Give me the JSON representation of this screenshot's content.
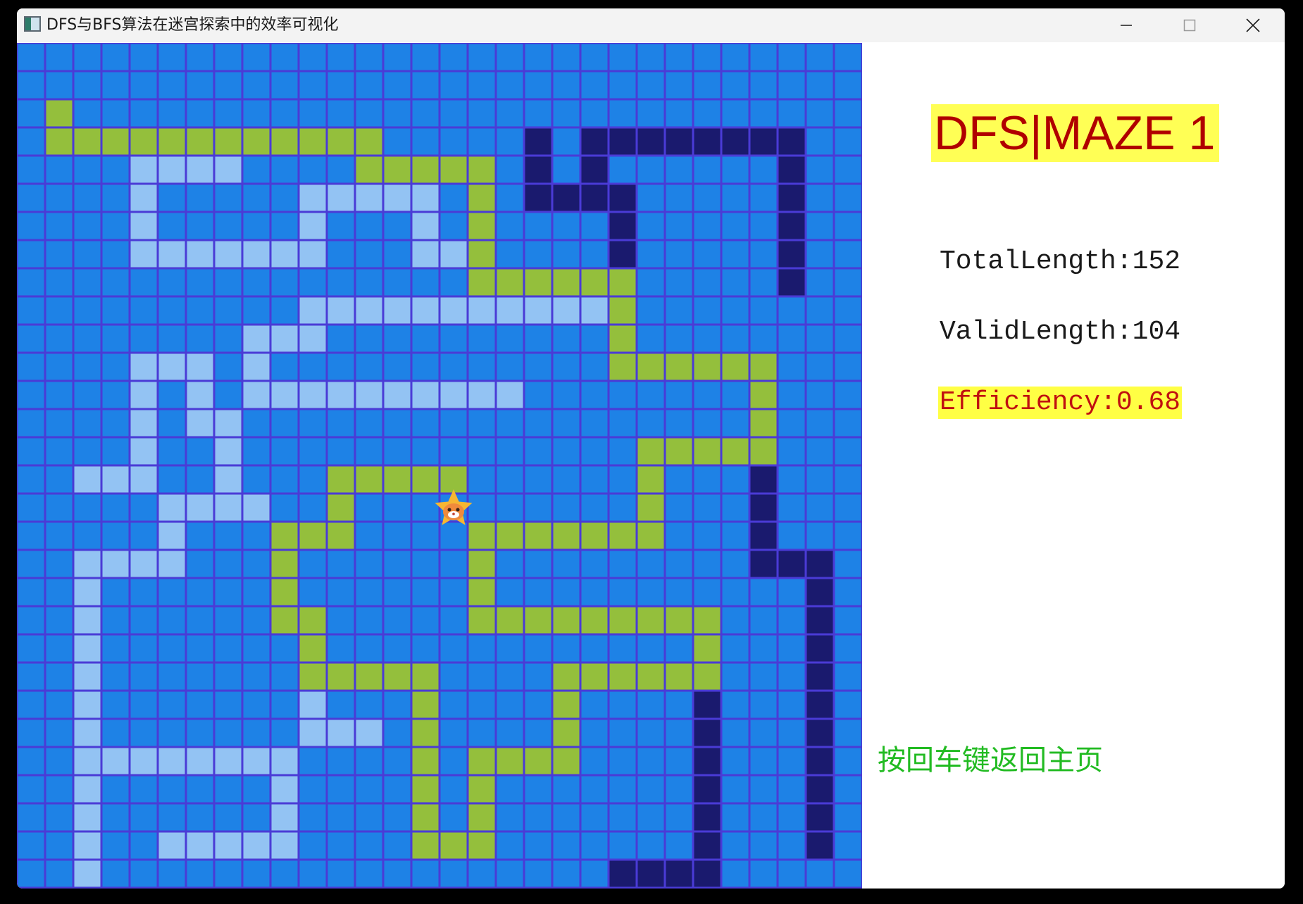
{
  "window": {
    "title": "DFS与BFS算法在迷宫探索中的效率可视化",
    "icon": "app-window-icon",
    "controls": [
      "minimize-icon",
      "maximize-icon",
      "close-icon"
    ]
  },
  "maze": {
    "cols": 30,
    "rows": 30,
    "colors": {
      "empty": "#1e82e6",
      "visited": "#93c3f3",
      "path": "#94bf3c",
      "dead_end": "#1a1a6e",
      "grid": "#4a3bd6"
    },
    "cells": {
      "visited": [
        [
          4,
          4
        ],
        [
          4,
          5
        ],
        [
          4,
          6
        ],
        [
          4,
          7
        ],
        [
          5,
          4
        ],
        [
          6,
          4
        ],
        [
          7,
          4
        ],
        [
          7,
          5
        ],
        [
          7,
          6
        ],
        [
          7,
          7
        ],
        [
          7,
          8
        ],
        [
          7,
          9
        ],
        [
          7,
          10
        ],
        [
          5,
          10
        ],
        [
          5,
          11
        ],
        [
          5,
          12
        ],
        [
          5,
          13
        ],
        [
          5,
          14
        ],
        [
          6,
          10
        ],
        [
          6,
          14
        ],
        [
          7,
          14
        ],
        [
          7,
          15
        ],
        [
          9,
          10
        ],
        [
          9,
          11
        ],
        [
          9,
          12
        ],
        [
          9,
          13
        ],
        [
          9,
          14
        ],
        [
          9,
          15
        ],
        [
          9,
          16
        ],
        [
          9,
          17
        ],
        [
          9,
          18
        ],
        [
          9,
          19
        ],
        [
          9,
          20
        ],
        [
          10,
          8
        ],
        [
          10,
          9
        ],
        [
          10,
          10
        ],
        [
          11,
          8
        ],
        [
          11,
          4
        ],
        [
          11,
          5
        ],
        [
          11,
          6
        ],
        [
          12,
          4
        ],
        [
          12,
          6
        ],
        [
          12,
          8
        ],
        [
          12,
          9
        ],
        [
          12,
          10
        ],
        [
          12,
          11
        ],
        [
          12,
          12
        ],
        [
          12,
          13
        ],
        [
          12,
          14
        ],
        [
          12,
          15
        ],
        [
          12,
          16
        ],
        [
          12,
          17
        ],
        [
          13,
          4
        ],
        [
          13,
          6
        ],
        [
          13,
          7
        ],
        [
          14,
          4
        ],
        [
          14,
          7
        ],
        [
          15,
          2
        ],
        [
          15,
          3
        ],
        [
          15,
          4
        ],
        [
          15,
          7
        ],
        [
          16,
          5
        ],
        [
          16,
          6
        ],
        [
          16,
          7
        ],
        [
          16,
          8
        ],
        [
          17,
          5
        ],
        [
          18,
          2
        ],
        [
          18,
          3
        ],
        [
          18,
          4
        ],
        [
          18,
          5
        ],
        [
          19,
          2
        ],
        [
          20,
          2
        ],
        [
          21,
          2
        ],
        [
          22,
          2
        ],
        [
          23,
          2
        ],
        [
          23,
          10
        ],
        [
          24,
          2
        ],
        [
          24,
          10
        ],
        [
          24,
          11
        ],
        [
          24,
          12
        ],
        [
          25,
          2
        ],
        [
          25,
          3
        ],
        [
          25,
          4
        ],
        [
          25,
          5
        ],
        [
          25,
          6
        ],
        [
          25,
          7
        ],
        [
          25,
          8
        ],
        [
          25,
          9
        ],
        [
          26,
          2
        ],
        [
          26,
          9
        ],
        [
          27,
          2
        ],
        [
          27,
          9
        ],
        [
          28,
          2
        ],
        [
          28,
          5
        ],
        [
          28,
          6
        ],
        [
          28,
          7
        ],
        [
          28,
          8
        ],
        [
          28,
          9
        ],
        [
          29,
          2
        ]
      ],
      "path": [
        [
          2,
          1
        ],
        [
          3,
          1
        ],
        [
          3,
          2
        ],
        [
          3,
          3
        ],
        [
          3,
          4
        ],
        [
          3,
          5
        ],
        [
          3,
          6
        ],
        [
          3,
          7
        ],
        [
          3,
          8
        ],
        [
          3,
          9
        ],
        [
          3,
          10
        ],
        [
          3,
          11
        ],
        [
          3,
          12
        ],
        [
          4,
          12
        ],
        [
          4,
          13
        ],
        [
          4,
          14
        ],
        [
          4,
          15
        ],
        [
          4,
          16
        ],
        [
          5,
          16
        ],
        [
          6,
          16
        ],
        [
          7,
          16
        ],
        [
          8,
          16
        ],
        [
          8,
          17
        ],
        [
          8,
          18
        ],
        [
          8,
          19
        ],
        [
          8,
          20
        ],
        [
          8,
          21
        ],
        [
          9,
          21
        ],
        [
          10,
          21
        ],
        [
          11,
          21
        ],
        [
          11,
          22
        ],
        [
          11,
          23
        ],
        [
          11,
          24
        ],
        [
          11,
          25
        ],
        [
          11,
          26
        ],
        [
          12,
          26
        ],
        [
          13,
          26
        ],
        [
          14,
          26
        ],
        [
          14,
          22
        ],
        [
          14,
          23
        ],
        [
          14,
          24
        ],
        [
          14,
          25
        ],
        [
          15,
          22
        ],
        [
          16,
          22
        ],
        [
          17,
          22
        ],
        [
          17,
          16
        ],
        [
          17,
          17
        ],
        [
          17,
          18
        ],
        [
          17,
          19
        ],
        [
          17,
          20
        ],
        [
          17,
          21
        ],
        [
          18,
          16
        ],
        [
          19,
          16
        ],
        [
          20,
          16
        ],
        [
          20,
          17
        ],
        [
          20,
          18
        ],
        [
          20,
          19
        ],
        [
          20,
          20
        ],
        [
          20,
          21
        ],
        [
          20,
          22
        ],
        [
          20,
          23
        ],
        [
          20,
          24
        ],
        [
          21,
          24
        ],
        [
          22,
          24
        ],
        [
          22,
          19
        ],
        [
          22,
          20
        ],
        [
          22,
          21
        ],
        [
          22,
          22
        ],
        [
          22,
          23
        ],
        [
          23,
          19
        ],
        [
          24,
          19
        ],
        [
          25,
          16
        ],
        [
          25,
          17
        ],
        [
          25,
          18
        ],
        [
          25,
          19
        ],
        [
          26,
          16
        ],
        [
          27,
          16
        ],
        [
          28,
          14
        ],
        [
          28,
          15
        ],
        [
          28,
          16
        ],
        [
          23,
          14
        ],
        [
          24,
          14
        ],
        [
          25,
          14
        ],
        [
          26,
          14
        ],
        [
          27,
          14
        ],
        [
          22,
          10
        ],
        [
          22,
          11
        ],
        [
          22,
          12
        ],
        [
          22,
          13
        ],
        [
          22,
          14
        ],
        [
          21,
          10
        ],
        [
          20,
          9
        ],
        [
          20,
          10
        ],
        [
          19,
          9
        ],
        [
          18,
          9
        ],
        [
          17,
          9
        ],
        [
          17,
          10
        ],
        [
          17,
          11
        ],
        [
          16,
          11
        ],
        [
          15,
          11
        ],
        [
          15,
          11
        ],
        [
          15,
          12
        ],
        [
          15,
          13
        ],
        [
          15,
          14
        ],
        [
          15,
          15
        ]
      ],
      "dead_end": [
        [
          3,
          18
        ],
        [
          3,
          20
        ],
        [
          3,
          21
        ],
        [
          3,
          22
        ],
        [
          3,
          23
        ],
        [
          3,
          24
        ],
        [
          3,
          25
        ],
        [
          3,
          26
        ],
        [
          3,
          27
        ],
        [
          4,
          18
        ],
        [
          4,
          20
        ],
        [
          4,
          27
        ],
        [
          5,
          18
        ],
        [
          5,
          19
        ],
        [
          5,
          20
        ],
        [
          5,
          21
        ],
        [
          5,
          27
        ],
        [
          6,
          21
        ],
        [
          6,
          27
        ],
        [
          7,
          21
        ],
        [
          7,
          27
        ],
        [
          8,
          27
        ],
        [
          15,
          26
        ],
        [
          16,
          26
        ],
        [
          17,
          26
        ],
        [
          18,
          26
        ],
        [
          18,
          27
        ],
        [
          18,
          28
        ],
        [
          19,
          28
        ],
        [
          20,
          28
        ],
        [
          21,
          28
        ],
        [
          22,
          28
        ],
        [
          23,
          28
        ],
        [
          24,
          28
        ],
        [
          25,
          28
        ],
        [
          26,
          28
        ],
        [
          27,
          28
        ],
        [
          28,
          28
        ],
        [
          23,
          24
        ],
        [
          24,
          24
        ],
        [
          25,
          24
        ],
        [
          26,
          24
        ],
        [
          27,
          24
        ],
        [
          28,
          24
        ],
        [
          29,
          21
        ],
        [
          29,
          22
        ],
        [
          29,
          23
        ],
        [
          29,
          24
        ]
      ]
    },
    "player": {
      "row": 16,
      "col": 15,
      "sprite": "cat-sprite-icon"
    }
  },
  "panel": {
    "title": "DFS|MAZE 1",
    "total_length": "TotalLength:152",
    "valid_length": "ValidLength:104",
    "efficiency": "Efficiency:0.68",
    "hint": "按回车键返回主页"
  }
}
